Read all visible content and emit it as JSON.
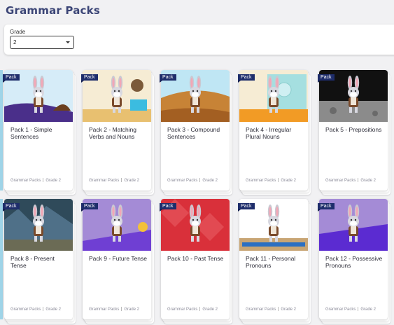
{
  "page": {
    "title": "Grammar Packs"
  },
  "filter": {
    "label": "Grade",
    "value": "2"
  },
  "cards": [
    {
      "badge": "Pack",
      "title": "Pack 1 - Simple Sentences",
      "category": "Grammar Packs",
      "grade": "Grade 2"
    },
    {
      "badge": "Pack",
      "title": "Pack 2 - Matching Verbs and Nouns",
      "category": "Grammar Packs",
      "grade": "Grade 2"
    },
    {
      "badge": "Pack",
      "title": "Pack 3 - Compound Sentences",
      "category": "Grammar Packs",
      "grade": "Grade 2"
    },
    {
      "badge": "Pack",
      "title": "Pack 4 - Irregular Plural Nouns",
      "category": "Grammar Packs",
      "grade": "Grade 2"
    },
    {
      "badge": "Pack",
      "title": "Pack 5 - Prepositions",
      "category": "Grammar Packs",
      "grade": "Grade 2"
    },
    {
      "badge": "Pack",
      "title": "Pack 8 - Present Tense",
      "category": "Grammar Packs",
      "grade": "Grade 2"
    },
    {
      "badge": "Pack",
      "title": "Pack 9 - Future Tense",
      "category": "Grammar Packs",
      "grade": "Grade 2"
    },
    {
      "badge": "Pack",
      "title": "Pack 10 - Past Tense",
      "category": "Grammar Packs",
      "grade": "Grade 2"
    },
    {
      "badge": "Pack",
      "title": "Pack 11 - Personal Pronouns",
      "category": "Grammar Packs",
      "grade": "Grade 2"
    },
    {
      "badge": "Pack",
      "title": "Pack 12 - Possessive Pronouns",
      "category": "Grammar Packs",
      "grade": "Grade 2"
    }
  ],
  "icons": {
    "dropdown": "chevron-down-icon",
    "character": "rabbit-character-icon"
  }
}
